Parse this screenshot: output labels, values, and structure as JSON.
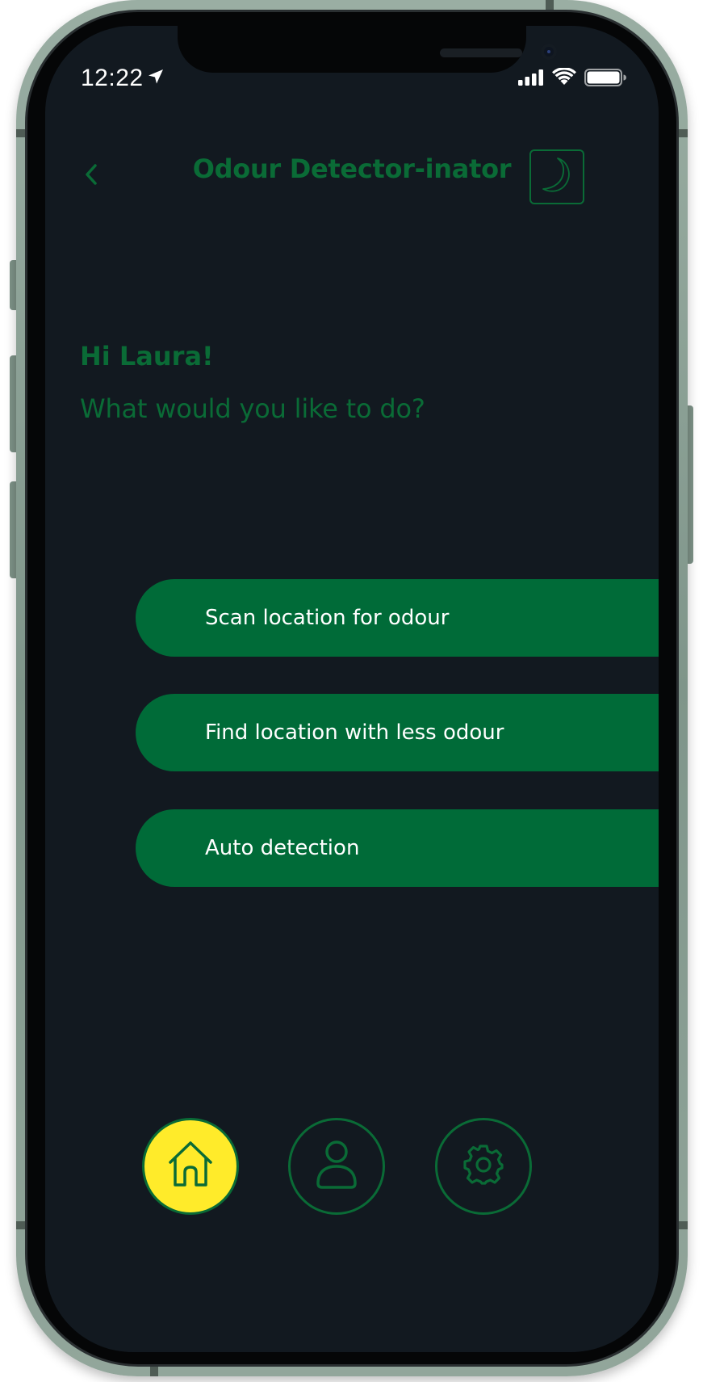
{
  "status_bar": {
    "time": "12:22",
    "location_icon": "location-arrow-icon",
    "signal_icon": "cellular-signal-icon",
    "wifi_icon": "wifi-icon",
    "battery_icon": "battery-icon"
  },
  "header": {
    "title": "Odour Detector-inator",
    "back_icon": "chevron-left-icon",
    "theme_icon": "moon-icon"
  },
  "greeting": {
    "hello": "Hi Laura!",
    "question": "What would you like to do?"
  },
  "actions": [
    {
      "label": "Scan location for odour"
    },
    {
      "label": "Find location with less odour"
    },
    {
      "label": "Auto detection"
    }
  ],
  "bottom_nav": [
    {
      "icon": "home-icon",
      "active": true
    },
    {
      "icon": "user-icon",
      "active": false
    },
    {
      "icon": "gear-icon",
      "active": false
    }
  ],
  "colors": {
    "background": "#121920",
    "accent_green": "#0a6b36",
    "button_green": "#006b38",
    "active_yellow": "#ffeb2a",
    "text_white": "#ffffff"
  }
}
